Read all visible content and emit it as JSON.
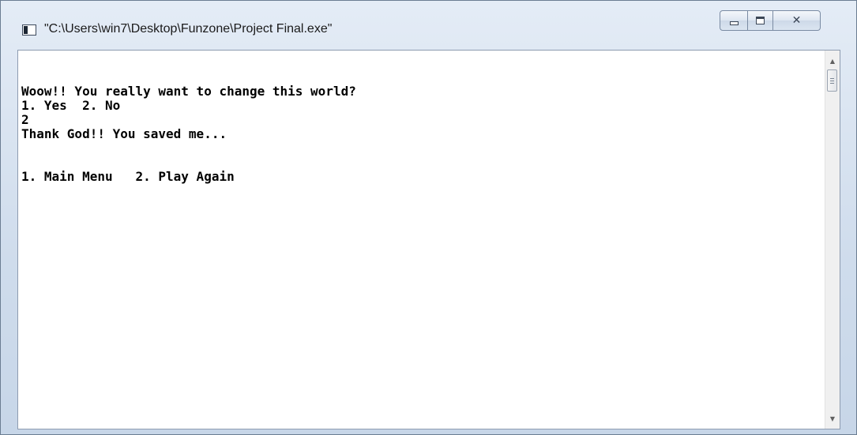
{
  "window": {
    "title": "\"C:\\Users\\win7\\Desktop\\Funzone\\Project Final.exe\"",
    "icon": "console-app-icon",
    "buttons": {
      "minimize": "minimize-icon",
      "maximize": "maximize-icon",
      "close": "close-icon",
      "close_glyph": "✕"
    }
  },
  "console": {
    "lines": [
      "",
      "Woow!! You really want to change this world?",
      "1. Yes  2. No",
      "2",
      "Thank God!! You saved me...",
      "",
      "",
      "1. Main Menu   2. Play Again"
    ],
    "text_color": "#000000",
    "background": "#ffffff"
  },
  "scrollbar": {
    "up_arrow": "▲",
    "down_arrow": "▼"
  }
}
